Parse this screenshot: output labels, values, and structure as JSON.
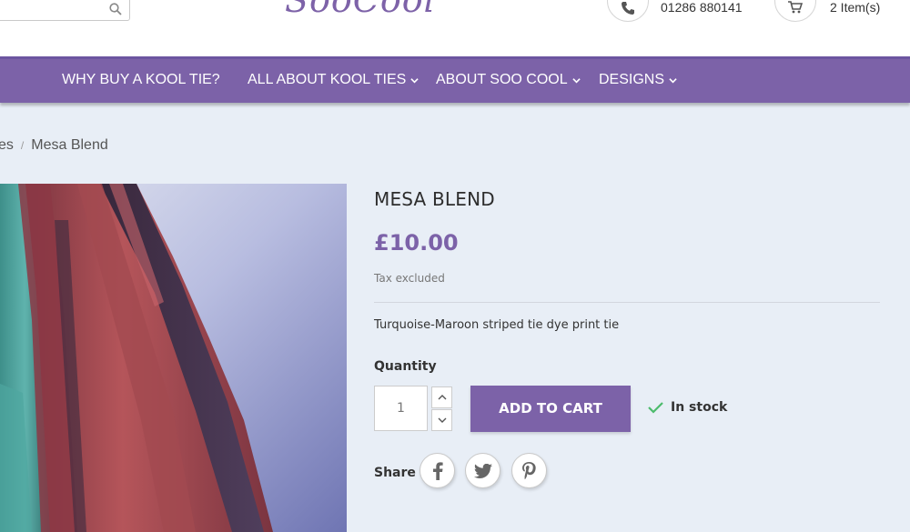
{
  "header": {
    "logo_text": "SooCool",
    "phone": "01286 880141",
    "cart_count": "2 Item(s)"
  },
  "nav": {
    "items": [
      {
        "label": "WHY BUY A KOOL TIE?",
        "dropdown": false
      },
      {
        "label": "ALL ABOUT KOOL TIES",
        "dropdown": true
      },
      {
        "label": "ABOUT SOO COOL",
        "dropdown": true
      },
      {
        "label": "DESIGNS",
        "dropdown": true
      }
    ]
  },
  "breadcrumb": {
    "previous": "es",
    "separator": "/",
    "current": "Mesa Blend"
  },
  "product": {
    "title": "MESA BLEND",
    "price": "£10.00",
    "tax_note": "Tax excluded",
    "description": "Turquoise-Maroon striped tie dye print tie",
    "quantity_label": "Quantity",
    "quantity_value": "1",
    "add_to_cart_label": "ADD TO CART",
    "stock_status": "In stock",
    "share_label": "Share"
  },
  "icons": {
    "search": "search-icon",
    "phone": "phone-icon",
    "cart": "cart-icon",
    "chevron": "chevron-down-icon",
    "check": "check-icon",
    "facebook": "facebook-icon",
    "twitter": "twitter-icon",
    "pinterest": "pinterest-icon"
  },
  "colors": {
    "accent": "#7c62a8",
    "background": "#e8eef6",
    "in_stock": "#4cbb6c"
  }
}
